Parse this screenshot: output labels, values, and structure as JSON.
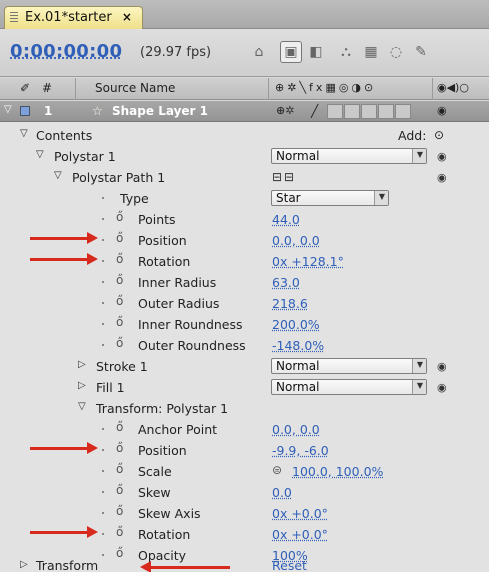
{
  "tab": {
    "label": "Ex.01*starter",
    "close": "×"
  },
  "timebar": {
    "timecode": "0:00:00:00",
    "fps": "(29.97 fps)"
  },
  "columns": {
    "hash": "#",
    "source_name": "Source Name"
  },
  "layer": {
    "number": "1",
    "name": "Shape Layer 1"
  },
  "contents": {
    "label": "Contents",
    "add_label": "Add:"
  },
  "rows": [
    {
      "label": "Polystar 1",
      "dropdown": "Normal"
    },
    {
      "label": "Polystar Path 1"
    },
    {
      "label": "Type",
      "dropdown": "Star"
    },
    {
      "label": "Points",
      "value": "44.0"
    },
    {
      "label": "Position",
      "value": "0.0, 0.0"
    },
    {
      "label": "Rotation",
      "value": "0x +128.1°"
    },
    {
      "label": "Inner Radius",
      "value": "63.0"
    },
    {
      "label": "Outer Radius",
      "value": "218.6"
    },
    {
      "label": "Inner Roundness",
      "value": "200.0%"
    },
    {
      "label": "Outer Roundness",
      "value": "-148.0%"
    },
    {
      "label": "Stroke 1",
      "dropdown": "Normal"
    },
    {
      "label": "Fill 1",
      "dropdown": "Normal"
    },
    {
      "label": "Transform: Polystar 1"
    },
    {
      "label": "Anchor Point",
      "value": "0.0, 0.0"
    },
    {
      "label": "Position",
      "value": "-9.9, -6.0"
    },
    {
      "label": "Scale",
      "value": "100.0, 100.0%"
    },
    {
      "label": "Skew",
      "value": "0.0"
    },
    {
      "label": "Skew Axis",
      "value": "0x +0.0°"
    },
    {
      "label": "Rotation",
      "value": "0x +0.0°"
    },
    {
      "label": "Opacity",
      "value": "100%"
    },
    {
      "label": "Transform",
      "value": "Reset"
    }
  ],
  "icons": {
    "stopwatch": "stopwatch-icon",
    "eye": "eye-icon",
    "arrow": "red-arrow-annotation"
  },
  "colors": {
    "value_blue": "#2f5fb8",
    "annotation_red": "#d72a1d",
    "tab_yellow": "#eee08a",
    "layer_label": "#7fa0d8"
  }
}
